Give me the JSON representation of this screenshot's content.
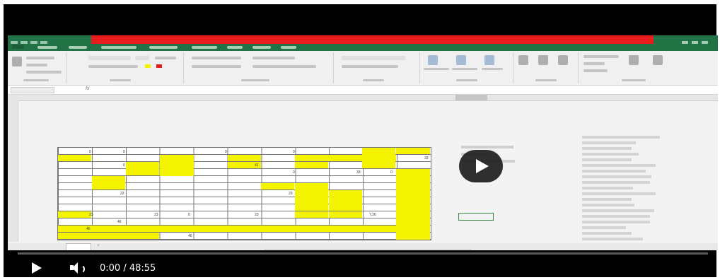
{
  "player": {
    "time_display": "0:00 / 48:55",
    "progress_fraction": 0.0,
    "play_button_icon": "play-icon",
    "volume_icon": "volume-icon",
    "progress_color": "#cc0000"
  },
  "excel": {
    "accent_color": "#217346",
    "highlight_color": "#f4f400",
    "title_bar_color": "#e81c1c"
  },
  "colors": {
    "taskbar": "#1f4a63",
    "play_overlay": "#191919",
    "notification_button": "#2a6bd0"
  }
}
